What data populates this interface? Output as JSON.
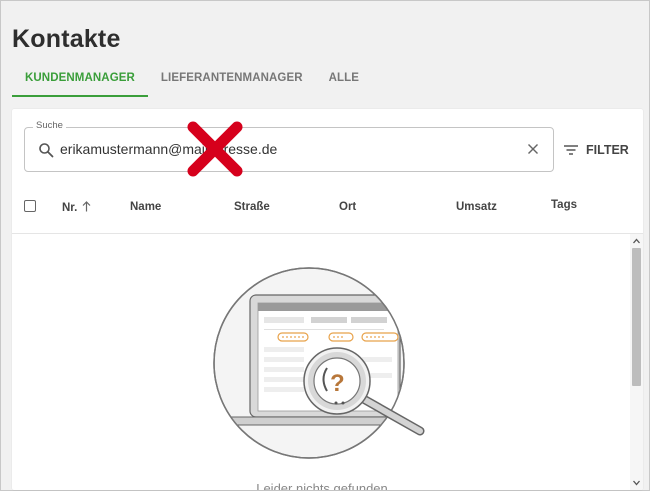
{
  "page": {
    "title": "Kontakte"
  },
  "tabs": [
    {
      "label": "KUNDENMANAGER",
      "active": true
    },
    {
      "label": "LIEFERANTENMANAGER",
      "active": false
    },
    {
      "label": "ALLE",
      "active": false
    }
  ],
  "search": {
    "label": "Suche",
    "value": "erikamustermann@mailadresse.de",
    "placeholder": ""
  },
  "filter": {
    "label": "FILTER"
  },
  "table": {
    "columns": [
      "Nr.",
      "Name",
      "Straße",
      "Ort",
      "Umsatz",
      "Tags"
    ],
    "sort_column": "Nr.",
    "sort_direction": "ascending"
  },
  "empty_state": {
    "text": "Leider nichts gefunden"
  },
  "icons": {
    "search": "search-icon",
    "clear": "close-icon",
    "filter": "filter-icon",
    "sort": "arrow-up-icon",
    "overlay": "red-x-icon"
  },
  "colors": {
    "accent": "#3a9e3a",
    "overlay_x": "#d6001c",
    "illustration_orange": "#e8a24a"
  }
}
